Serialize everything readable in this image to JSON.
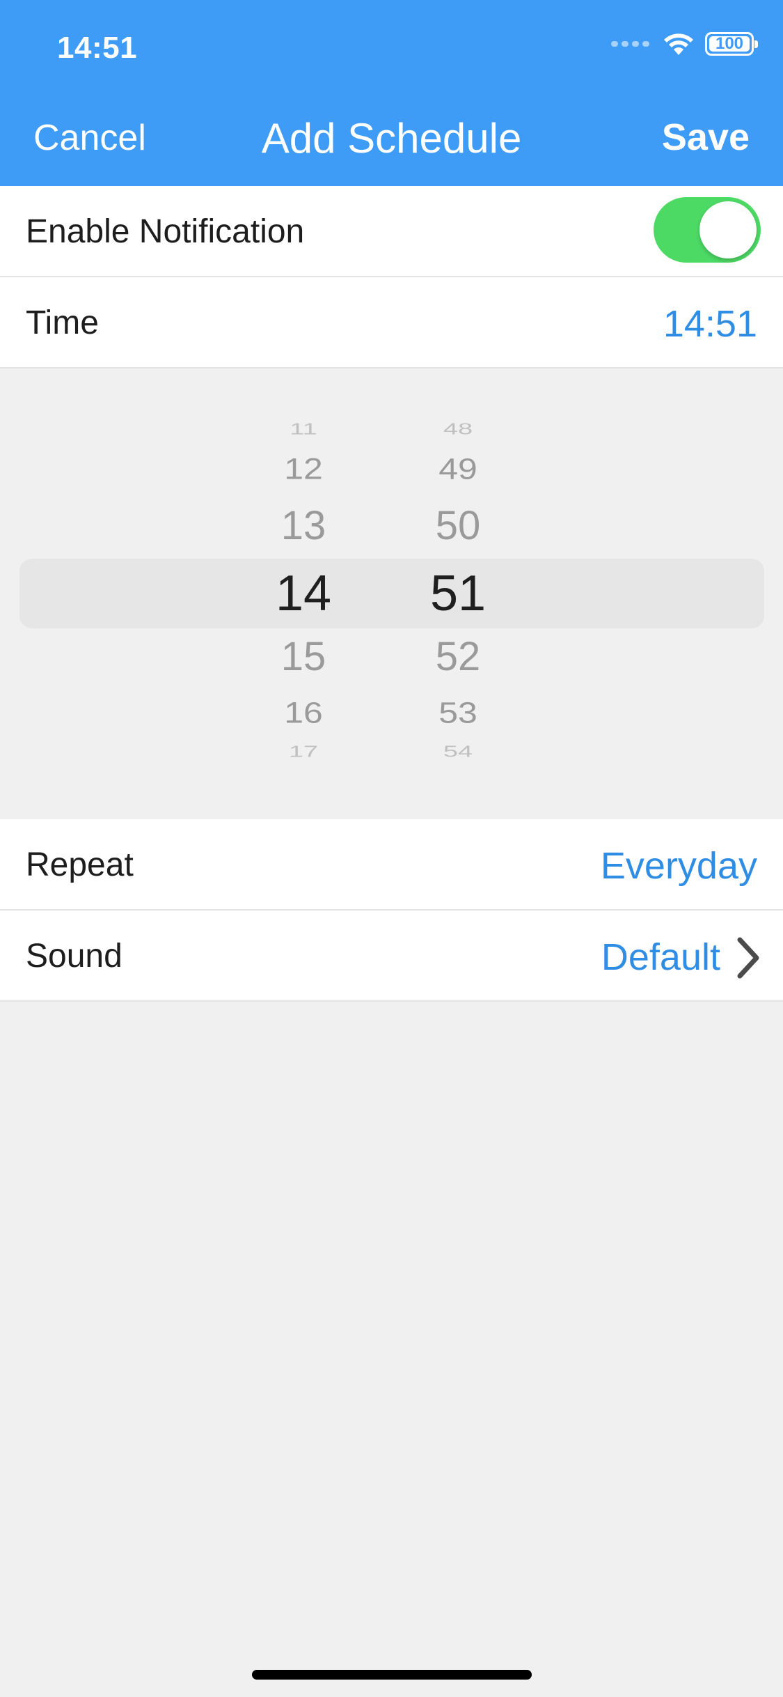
{
  "status_bar": {
    "time": "14:51",
    "battery": "100"
  },
  "nav": {
    "cancel": "Cancel",
    "title": "Add Schedule",
    "save": "Save"
  },
  "rows": {
    "enable_notification": {
      "label": "Enable Notification",
      "enabled": true
    },
    "time": {
      "label": "Time",
      "value": "14:51"
    },
    "repeat": {
      "label": "Repeat",
      "value": "Everyday"
    },
    "sound": {
      "label": "Sound",
      "value": "Default"
    }
  },
  "picker": {
    "hours": [
      "11",
      "12",
      "13",
      "14",
      "15",
      "16",
      "17"
    ],
    "minutes": [
      "48",
      "49",
      "50",
      "51",
      "52",
      "53",
      "54"
    ],
    "selected_hour": "14",
    "selected_minute": "51"
  },
  "colors": {
    "header": "#3f9cf6",
    "accent": "#2f8de4",
    "toggle_on": "#4cd964",
    "background": "#f0f0f0"
  },
  "icons": {
    "wifi": "wifi-icon",
    "battery": "battery-icon",
    "signal": "signal-icon",
    "chevron": "chevron-right-icon"
  }
}
